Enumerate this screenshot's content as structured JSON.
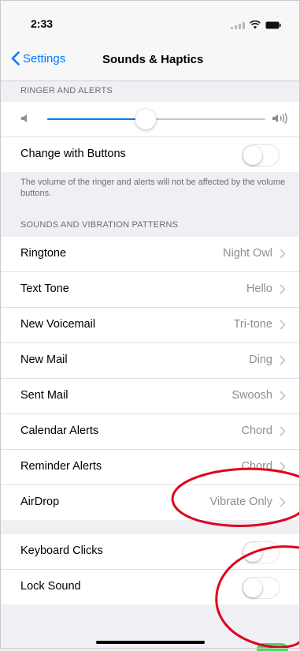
{
  "status_bar": {
    "time": "2:33"
  },
  "nav": {
    "back_label": "Settings",
    "title": "Sounds & Haptics"
  },
  "ringer": {
    "header": "RINGER AND ALERTS",
    "volume_level": 0.45,
    "change_with_buttons_label": "Change with Buttons",
    "change_with_buttons_on": false,
    "footer": "The volume of the ringer and alerts will not be affected by the volume buttons."
  },
  "sounds": {
    "header": "SOUNDS AND VIBRATION PATTERNS",
    "items": [
      {
        "label": "Ringtone",
        "value": "Night Owl"
      },
      {
        "label": "Text Tone",
        "value": "Hello"
      },
      {
        "label": "New Voicemail",
        "value": "Tri-tone"
      },
      {
        "label": "New Mail",
        "value": "Ding"
      },
      {
        "label": "Sent Mail",
        "value": "Swoosh"
      },
      {
        "label": "Calendar Alerts",
        "value": "Chord"
      },
      {
        "label": "Reminder Alerts",
        "value": "Chord"
      },
      {
        "label": "AirDrop",
        "value": "Vibrate Only"
      }
    ]
  },
  "system": {
    "keyboard_clicks_label": "Keyboard Clicks",
    "keyboard_clicks_on": false,
    "lock_sound_label": "Lock Sound",
    "lock_sound_on": false
  },
  "colors": {
    "accent": "#007aff",
    "annotation": "#e0001b",
    "background": "#efeff4"
  }
}
